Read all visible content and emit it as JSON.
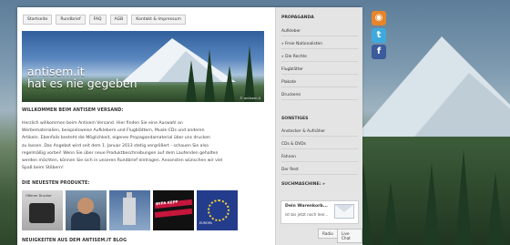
{
  "nav": [
    "Startseite",
    "Rundbrief",
    "FAQ",
    "AGB",
    "Kontakt & Impressum"
  ],
  "hero": {
    "line1": "antisem.it",
    "line2": "hat es nie gegeben",
    "copyright": "© antisem.it"
  },
  "welcome": {
    "title": "WILLKOMMEN BEIM ANTISEM VERSAND:",
    "lines": [
      "Herzlich willkommen beim Antisem Versand. Hier finden Sie eine Auswahl an",
      "Werbematerialien, beispielsweise Aufklebern und Flugblättern, Musik-CDs und anderen",
      "Artikeln. Ebenfalls besteht die Möglichkeit, eigenes Propagandamaterial über uns drucken",
      "zu lassen. Das Angebot wird seit dem 1. Januar 2013 stetig vergrößert - schauen Sie also",
      "regelmäßig vorbei! Wenn Sie über neue Produktbeschreibungen auf dem Laufenden gehalten",
      "werden möchten, können Sie sich in unseren Rundbrief eintragen. Ansonsten wünschen wir viel",
      "Spaß beim Stöbern!"
    ]
  },
  "products": {
    "title": "DIE NEUESTEN PRODUKTE:",
    "p1_label": "Offener Drucker",
    "p4_label": "BYPA KEPP",
    "p5_label": "EUROPA"
  },
  "blog": {
    "title": "NEUIGKEITEN AUS DEM ANTISEM.IT BLOG"
  },
  "sidebar": {
    "propaganda_title": "PROPAGANDA",
    "propaganda_items": [
      "Aufkleber",
      "» Freie Nationalisten",
      "» Die Rechte",
      "Flugblätter",
      "Plakate",
      "Druckerei"
    ],
    "other_title": "SONSTIGES",
    "other_items": [
      "Anstecker & Aufnäher",
      "CDs & DVDs",
      "Fahnen",
      "Der Rest"
    ],
    "search_title": "SUCHMASCHINE: »",
    "cart_title": "Dein Warenkorb...",
    "cart_body": "ist bis jetzt noch leer...",
    "radio_label": "Radio",
    "chat_label": "Live Chat"
  },
  "social": {
    "rss": "rss-icon",
    "twitter": "twitter-icon",
    "facebook": "facebook-icon"
  }
}
